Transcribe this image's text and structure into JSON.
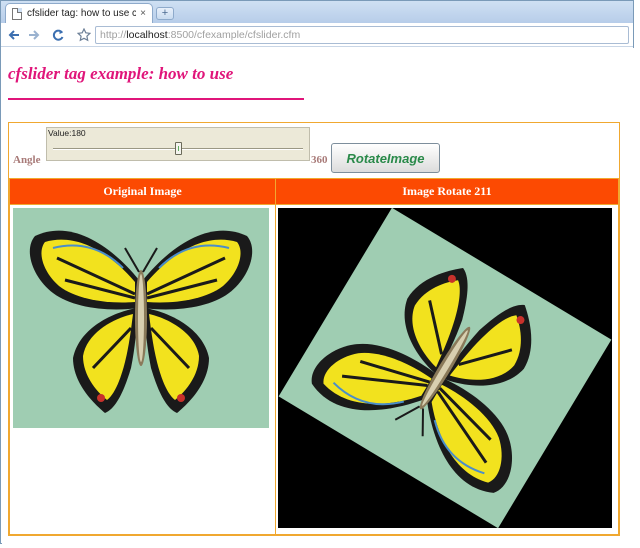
{
  "browser": {
    "tab_title": "cfslider tag: how to use cfs...",
    "tab_close": "×",
    "new_tab": "+",
    "url_prefix": "http://",
    "url_host": "localhost",
    "url_rest": ":8500/cfexample/cfslider.cfm"
  },
  "page": {
    "title": "cfslider tag example: how to use"
  },
  "form": {
    "angle_label": "Angle",
    "slider_value_text": "Value:180",
    "slider_value": 180,
    "slider_min": 0,
    "slider_max": 360,
    "slider_max_label": "360",
    "button_label": "RotateImage"
  },
  "table": {
    "headers": [
      "Original Image",
      "Image Rotate 211"
    ]
  },
  "images": {
    "original": {
      "subject": "butterfly",
      "rotation_deg": 0,
      "background": "#9fcdb2"
    },
    "rotated": {
      "subject": "butterfly",
      "rotation_deg": 211,
      "background": "#000000"
    }
  },
  "colors": {
    "title": "#e0157a",
    "header_bg": "#fc4a02",
    "frame_border": "#f0a830",
    "button_text": "#2a8a4a"
  }
}
